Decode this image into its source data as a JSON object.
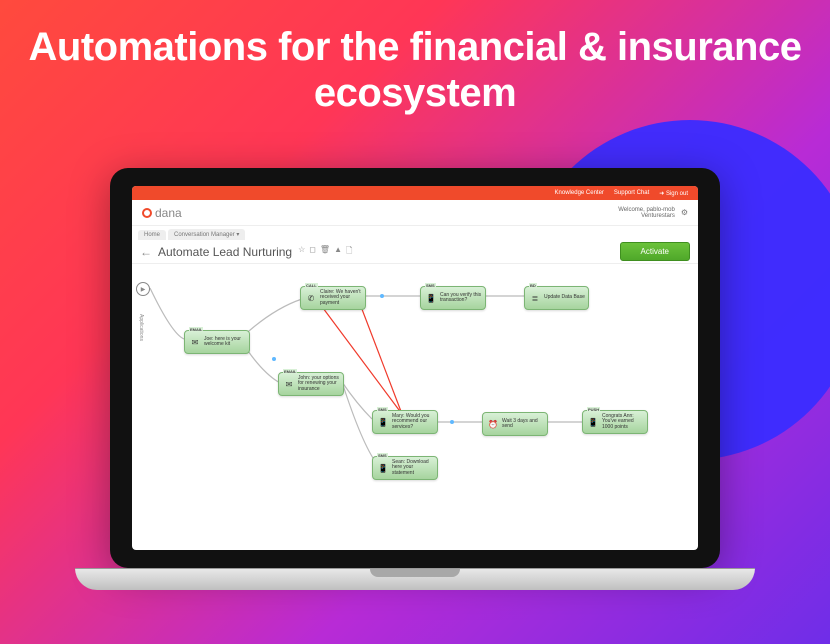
{
  "hero": "Automations for the financial & insurance ecosystem",
  "top": {
    "kc": "Knowledge Center",
    "sc": "Support Chat",
    "so": "➜ Sign out"
  },
  "brand": "dana",
  "meta": {
    "welcome": "Welcome, pablo-mob",
    "org": "Venturestars"
  },
  "tabs": {
    "home": "Home",
    "cm": "Conversation Manager ▾"
  },
  "title": "Automate Lead Nurturing",
  "activate": "Activate",
  "apps": "Applications",
  "nodes": {
    "email1": {
      "type": "EMAIL",
      "text": "Joe: here is your welcome kit"
    },
    "call": {
      "type": "CALL",
      "text": "Claire: We haven't received your payment"
    },
    "email2": {
      "type": "EMAIL",
      "text": "John: your options for renewing your insurance"
    },
    "sms1": {
      "type": "SMS",
      "text": "Can you verify this transaction?"
    },
    "bd": {
      "type": "BD",
      "text": "Update Data Base"
    },
    "sms2": {
      "type": "SMS",
      "text": "Mary: Would you recommend our services?"
    },
    "sms3": {
      "type": "SMS",
      "text": "Sean: Download here your statement"
    },
    "wait": {
      "type": "WAIT",
      "text": "Wait 3 days and send"
    },
    "push": {
      "type": "PUSH",
      "text": "Congrats Ann: You've earned 1000 points"
    }
  }
}
